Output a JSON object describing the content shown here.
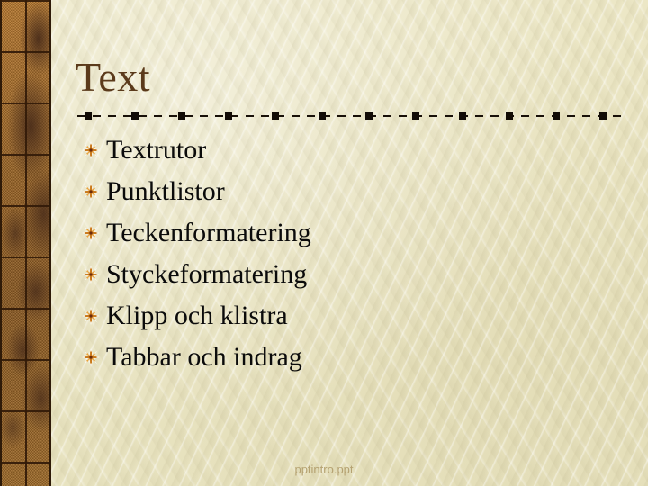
{
  "slide": {
    "title": "Text",
    "background_color": "#ece7c6",
    "title_color": "#5b3a1b",
    "accent_color": "#b87a31",
    "text_color": "#0b0b0b",
    "footer_color": "#b5a271"
  },
  "divider": {
    "name": "dashed-divider",
    "marker_count": 12,
    "marker_spacing": 52
  },
  "bullets": [
    {
      "label": "Textrutor",
      "icon": "star-burst-bullet-icon"
    },
    {
      "label": "Punktlistor",
      "icon": "star-burst-bullet-icon"
    },
    {
      "label": "Teckenformatering",
      "icon": "star-burst-bullet-icon"
    },
    {
      "label": "Styckeformatering",
      "icon": "star-burst-bullet-icon"
    },
    {
      "label": "Klipp och klistra",
      "icon": "star-burst-bullet-icon"
    },
    {
      "label": "Tabbar och indrag",
      "icon": "star-burst-bullet-icon"
    }
  ],
  "footer": {
    "text": "pptintro.ppt"
  }
}
